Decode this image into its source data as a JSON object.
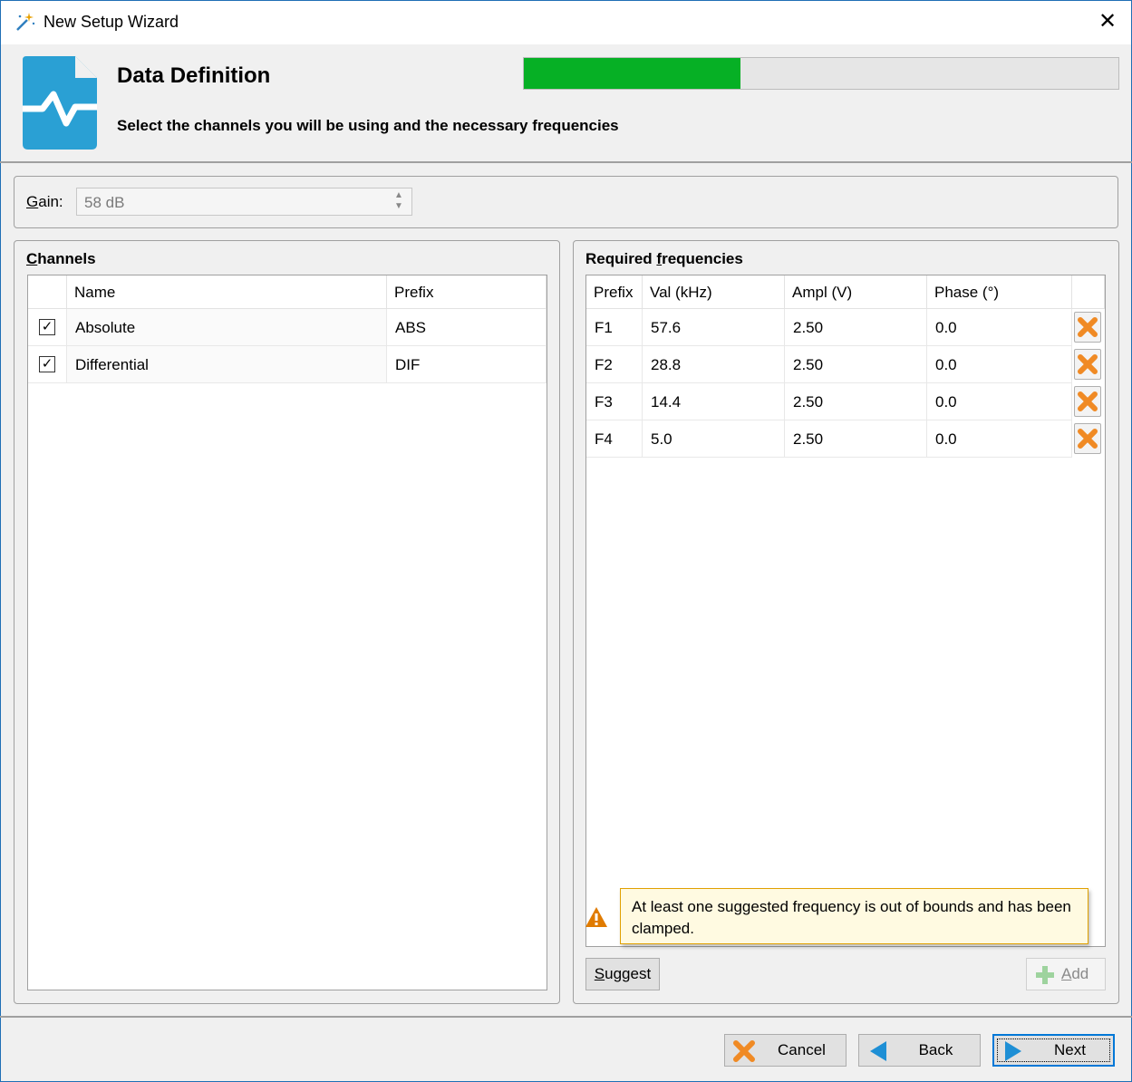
{
  "window": {
    "title": "New Setup Wizard",
    "close_glyph": "✕"
  },
  "header": {
    "title": "Data Definition",
    "subtitle": "Select the channels you will be using and the necessary frequencies",
    "progress_fraction": 0.365
  },
  "gain": {
    "label_accel": "G",
    "label_rest": "ain:",
    "value": "58 dB"
  },
  "channels": {
    "title_accel": "C",
    "title_rest": "hannels",
    "columns": [
      "Name",
      "Prefix"
    ],
    "rows": [
      {
        "checked": true,
        "name": "Absolute",
        "prefix": "ABS"
      },
      {
        "checked": true,
        "name": "Differential",
        "prefix": "DIF"
      }
    ]
  },
  "frequencies": {
    "title_pre": "Required ",
    "title_accel": "f",
    "title_rest": "requencies",
    "columns": [
      "Prefix",
      "Val (kHz)",
      "Ampl (V)",
      "Phase (°)"
    ],
    "rows": [
      {
        "prefix": "F1",
        "val": "57.6",
        "ampl": "2.50",
        "phase": "0.0"
      },
      {
        "prefix": "F2",
        "val": "28.8",
        "ampl": "2.50",
        "phase": "0.0"
      },
      {
        "prefix": "F3",
        "val": "14.4",
        "ampl": "2.50",
        "phase": "0.0"
      },
      {
        "prefix": "F4",
        "val": "5.0",
        "ampl": "2.50",
        "phase": "0.0"
      }
    ],
    "warning": "At least one suggested frequency is out of bounds and has been clamped.",
    "suggest_accel": "S",
    "suggest_rest": "uggest",
    "add_accel": "A",
    "add_rest": "dd"
  },
  "footer": {
    "cancel": "Cancel",
    "back": "Back",
    "next": "Next"
  },
  "colors": {
    "accent": "#06b025",
    "brand": "#2aa0d4",
    "delete": "#f08a24",
    "warning": "#e07b00"
  },
  "icons": {
    "title": "magic-wand-icon",
    "header": "waveform-document-icon",
    "delete": "delete-x-icon",
    "warning": "warning-icon",
    "add": "plus-icon",
    "back": "back-arrow-icon",
    "next": "next-arrow-icon",
    "cancel": "cancel-x-icon"
  }
}
